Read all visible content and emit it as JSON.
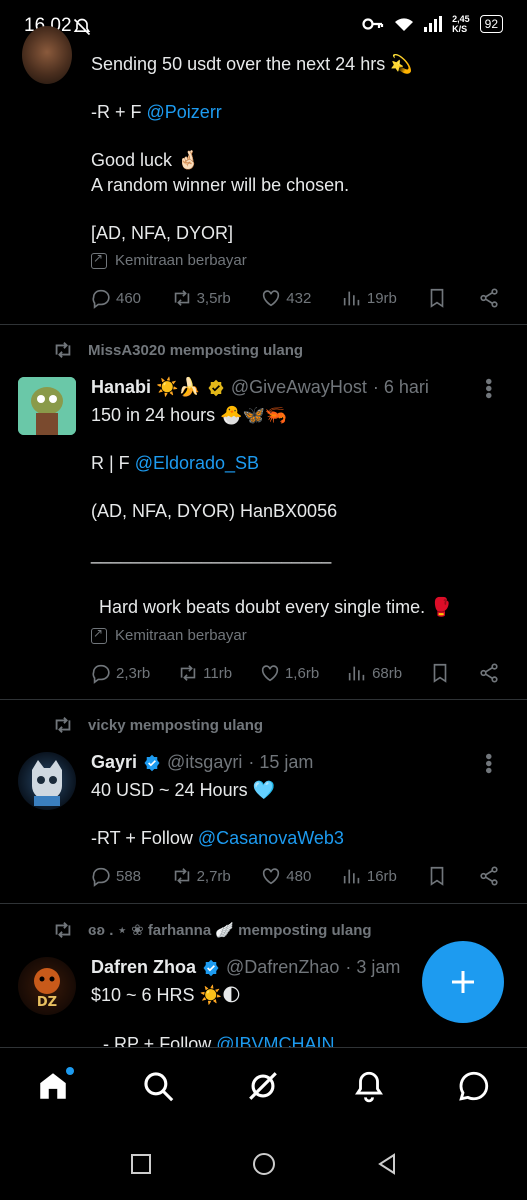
{
  "status_bar": {
    "time": "16.02",
    "speed_value": "2,45",
    "speed_unit": "K/S",
    "battery": "92"
  },
  "tweets": [
    {
      "lines": [
        "Sending 50 usdt over the next 24 hrs 💫"
      ],
      "rf_prefix": "-R + F ",
      "rf_link": "@Poizerr",
      "good_luck": "Good luck 🤞🏻",
      "winner": "A random winner will be chosen.",
      "disclaimer": "[AD, NFA, DYOR]",
      "paid_label": "Kemitraan berbayar",
      "actions": {
        "replies": "460",
        "reposts": "3,5rb",
        "likes": "432",
        "views": "19rb"
      }
    },
    {
      "repost_by": "MissA3020 memposting ulang",
      "name": "Hanabi ☀️🍌",
      "handle": "@GiveAwayHost",
      "time": "· 6 hari",
      "line1": "150 in 24 hours 🐣🦋🦐",
      "rf_prefix": "R | F ",
      "rf_link": "@Eldorado_SB",
      "disclaimer": "(AD, NFA, DYOR) HanBX0056",
      "separator": "________________________",
      "quote": "Hard work beats doubt every single time. 🥊",
      "paid_label": "Kemitraan berbayar",
      "actions": {
        "replies": "2,3rb",
        "reposts": "11rb",
        "likes": "1,6rb",
        "views": "68rb"
      }
    },
    {
      "repost_by": "vicky memposting ulang",
      "name": "Gayri",
      "handle": "@itsgayri",
      "time": "· 15 jam",
      "line1": "40 USD ~ 24 Hours 🩵",
      "rf_prefix": "-RT + Follow ",
      "rf_link": "@CasanovaWeb3",
      "actions": {
        "replies": "588",
        "reposts": "2,7rb",
        "likes": "480",
        "views": "16rb"
      }
    },
    {
      "repost_by": "ɞʚ . ⋆ ❀ farhanna 🪽 memposting ulang",
      "name": "Dafren Zhoa",
      "handle": "@DafrenZhao",
      "time": "· 3 jam",
      "line1": "$10 ~ 6 HRS ☀️🌓",
      "rf_prefix": "- RP + Follow ",
      "rf_link": "@IBVMCHAIN"
    }
  ],
  "avatar_text": {
    "dz": "DZ"
  },
  "colors": {
    "accent": "#1d9bf0",
    "muted": "#71767b",
    "background": "#000000",
    "verified": "#1d9bf0"
  },
  "icons": [
    "reply-icon",
    "repost-icon",
    "like-icon",
    "views-icon",
    "bookmark-icon",
    "share-icon",
    "more-icon",
    "home-icon",
    "search-icon",
    "grok-icon",
    "notifications-icon",
    "messages-icon",
    "plus-icon"
  ]
}
